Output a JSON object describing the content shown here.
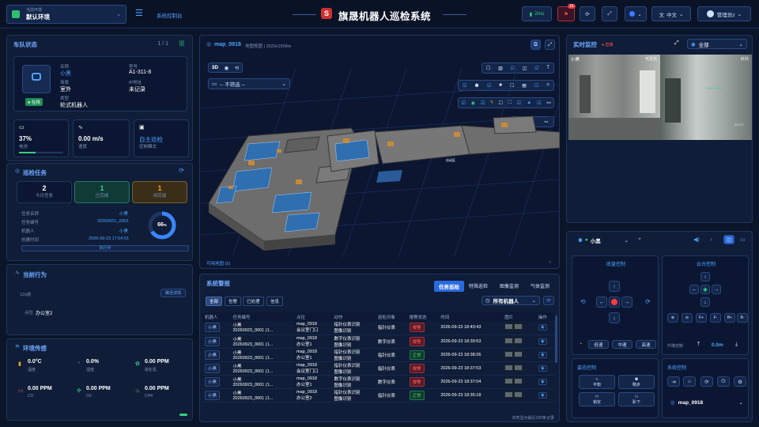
{
  "header": {
    "env_label": "当前环境",
    "env_value": "默认环境",
    "console": "系统控制台",
    "title": "旗晟机器人巡检系统",
    "latency": "2ms",
    "alerts": "16",
    "lang": "中文",
    "user": "管理员z"
  },
  "fleet": {
    "title": "车队状态",
    "page": "1 / 1",
    "status": "在线",
    "name_label": "名称",
    "name": "小黑",
    "id_label": "型号",
    "id": "A1-311-8",
    "site_label": "场景",
    "site": "室外",
    "ip_label": "IP地址",
    "ip": "未记录",
    "type_label": "类型",
    "type": "轮式机器人",
    "battery": "37%",
    "battery_label": "电池",
    "battery_level": 0.37,
    "speed": "0.00 m/s",
    "speed_label": "速度",
    "mode": "自主巡检",
    "mode_label": "控制模式"
  },
  "tasks": {
    "title": "巡检任务",
    "today": "2",
    "today_label": "今日任务",
    "done": "1",
    "done_label": "已完成",
    "pending": "1",
    "pending_label": "待完成",
    "name_label": "任务名称",
    "name": "小黑",
    "no_label": "任务编号",
    "no": "20260921_0001",
    "robot_label": "机器人",
    "robot": "小黑",
    "time_label": "创建时间",
    "time": "2026-09-23 17:04:51",
    "progress": "66",
    "progress_unit": "%",
    "progress_value": 0.66,
    "state": "执行中"
  },
  "behavior": {
    "title": "当前行为",
    "count": "12s前",
    "detail_btn": "路径详情",
    "loc_label": "点位",
    "loc": "办公室2"
  },
  "env": {
    "title": "环境传感",
    "items": [
      {
        "value": "0.0°C",
        "label": "温度"
      },
      {
        "value": "0.0%",
        "label": "湿度"
      },
      {
        "value": "0.00 PPM",
        "label": "硫化氢"
      },
      {
        "value": "0.00 PPM",
        "label": "CO"
      },
      {
        "value": "0.00 PPM",
        "label": "O2"
      },
      {
        "value": "0.00 PPM",
        "label": "CH4"
      }
    ]
  },
  "map": {
    "title": "map_0918",
    "subtitle": "地图视图 | 1623x1509m",
    "mode3d": "3D",
    "filter": "-- 不筛选 --",
    "footer": "可用地图 (5)",
    "label": "启动区"
  },
  "alarms": {
    "title": "系统警报",
    "tabs": [
      "任务巡检",
      "特殊巡检",
      "图像监测",
      "气体监测"
    ],
    "filters": [
      "全部",
      "告警",
      "已处理",
      "信息"
    ],
    "robot_select": "所有机器人",
    "columns": [
      "机器人",
      "任务编号",
      "点位",
      "动作",
      "巡检对象",
      "报警状态",
      "时间",
      "图片",
      "操作"
    ],
    "rows": [
      {
        "robot": "小黑",
        "task": "小黑\n20260923_0001 (1...",
        "point": "map_0918\n会议室门口",
        "action": "指针仪表识别\n图像识别",
        "target": "指针仪表",
        "status": "报警",
        "time": "2026-09-23 18:40:43"
      },
      {
        "robot": "小黑",
        "task": "小黑\n20260923_0001 (1...",
        "point": "map_0918\n办公室1",
        "action": "数字仪表识别\n图像识别",
        "target": "数字仪表",
        "status": "报警",
        "time": "2026-09-23 18:39:53"
      },
      {
        "robot": "小黑",
        "task": "小黑\n20260923_0001 (1...",
        "point": "map_0918\n办公室1",
        "action": "指针仪表识别\n图像识别",
        "target": "指针仪表",
        "status": "正常",
        "time": "2026-09-23 18:38:26"
      },
      {
        "robot": "小黑",
        "task": "小黑\n20260923_0001 (1...",
        "point": "map_0918\n会议室门口",
        "action": "指针仪表识别\n图像识别",
        "target": "指针仪表",
        "status": "报警",
        "time": "2026-09-23 18:37:53"
      },
      {
        "robot": "小黑",
        "task": "小黑\n20260923_0001 (1...",
        "point": "map_0918\n办公室1",
        "action": "数字仪表识别\n图像识别",
        "target": "数字仪表",
        "status": "报警",
        "time": "2026-09-23 18:37:04"
      },
      {
        "robot": "小黑",
        "task": "小黑\n20260923_0001 (1...",
        "point": "map_0918\n办公室2",
        "action": "指针仪表识别\n图像识别",
        "target": "指针仪表",
        "status": "正常",
        "time": "2026-09-23 18:35:18"
      }
    ],
    "footer": "实时显示最近100条记录"
  },
  "monitor": {
    "title": "实时监控",
    "rec": "● 直播",
    "scope": "全部",
    "cam1": "小黑",
    "cam1_tag": "可见光",
    "cam2_tag": "红外"
  },
  "control": {
    "robot": "小黑",
    "chassis_title": "底盘控制",
    "gimbal_title": "云台控制",
    "speed_labels": [
      "低速",
      "中速",
      "高速"
    ],
    "lift_label": "升降控制",
    "lift_value": "0.0m",
    "state_title": "姿态控制",
    "state_btns": [
      "平衡",
      "略步",
      "锁定",
      "趴下"
    ],
    "sys_title": "系统控制",
    "map": "map_0918"
  }
}
